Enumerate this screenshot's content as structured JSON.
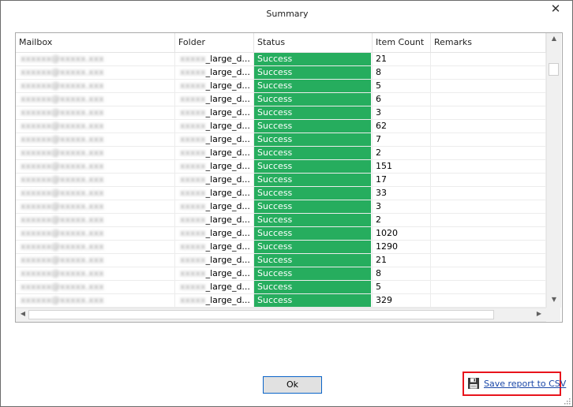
{
  "window": {
    "title": "Summary",
    "close_glyph": "✕"
  },
  "grid": {
    "columns": [
      "Mailbox",
      "Folder",
      "Status",
      "Item Count",
      "Remarks"
    ],
    "rows": [
      {
        "mailbox": "xxxxxx@xxxxx.xxx",
        "folder_prefix": "xxxxx",
        "folder": "_large_d...",
        "status": "Success",
        "count": "21",
        "remarks": ""
      },
      {
        "mailbox": "xxxxxx@xxxxx.xxx",
        "folder_prefix": "xxxxx",
        "folder": "_large_d...",
        "status": "Success",
        "count": "8",
        "remarks": ""
      },
      {
        "mailbox": "xxxxxx@xxxxx.xxx",
        "folder_prefix": "xxxxx",
        "folder": "_large_d...",
        "status": "Success",
        "count": "5",
        "remarks": ""
      },
      {
        "mailbox": "xxxxxx@xxxxx.xxx",
        "folder_prefix": "xxxxx",
        "folder": "_large_d...",
        "status": "Success",
        "count": "6",
        "remarks": ""
      },
      {
        "mailbox": "xxxxxx@xxxxx.xxx",
        "folder_prefix": "xxxxx",
        "folder": "_large_d...",
        "status": "Success",
        "count": "3",
        "remarks": ""
      },
      {
        "mailbox": "xxxxxx@xxxxx.xxx",
        "folder_prefix": "xxxxx",
        "folder": "_large_d...",
        "status": "Success",
        "count": "62",
        "remarks": ""
      },
      {
        "mailbox": "xxxxxx@xxxxx.xxx",
        "folder_prefix": "xxxxx",
        "folder": "_large_d...",
        "status": "Success",
        "count": "7",
        "remarks": ""
      },
      {
        "mailbox": "xxxxxx@xxxxx.xxx",
        "folder_prefix": "xxxxx",
        "folder": "_large_d...",
        "status": "Success",
        "count": "2",
        "remarks": ""
      },
      {
        "mailbox": "xxxxxx@xxxxx.xxx",
        "folder_prefix": "xxxxx",
        "folder": "_large_d...",
        "status": "Success",
        "count": "151",
        "remarks": ""
      },
      {
        "mailbox": "xxxxxx@xxxxx.xxx",
        "folder_prefix": "xxxxx",
        "folder": "_large_d...",
        "status": "Success",
        "count": "17",
        "remarks": ""
      },
      {
        "mailbox": "xxxxxx@xxxxx.xxx",
        "folder_prefix": "xxxxx",
        "folder": "_large_d...",
        "status": "Success",
        "count": "33",
        "remarks": ""
      },
      {
        "mailbox": "xxxxxx@xxxxx.xxx",
        "folder_prefix": "xxxxx",
        "folder": "_large_d...",
        "status": "Success",
        "count": "3",
        "remarks": ""
      },
      {
        "mailbox": "xxxxxx@xxxxx.xxx",
        "folder_prefix": "xxxxx",
        "folder": "_large_d...",
        "status": "Success",
        "count": "2",
        "remarks": ""
      },
      {
        "mailbox": "xxxxxx@xxxxx.xxx",
        "folder_prefix": "xxxxx",
        "folder": "_large_d...",
        "status": "Success",
        "count": "1020",
        "remarks": ""
      },
      {
        "mailbox": "xxxxxx@xxxxx.xxx",
        "folder_prefix": "xxxxx",
        "folder": "_large_d...",
        "status": "Success",
        "count": "1290",
        "remarks": ""
      },
      {
        "mailbox": "xxxxxx@xxxxx.xxx",
        "folder_prefix": "xxxxx",
        "folder": "_large_d...",
        "status": "Success",
        "count": "21",
        "remarks": ""
      },
      {
        "mailbox": "xxxxxx@xxxxx.xxx",
        "folder_prefix": "xxxxx",
        "folder": "_large_d...",
        "status": "Success",
        "count": "8",
        "remarks": ""
      },
      {
        "mailbox": "xxxxxx@xxxxx.xxx",
        "folder_prefix": "xxxxx",
        "folder": "_large_d...",
        "status": "Success",
        "count": "5",
        "remarks": ""
      },
      {
        "mailbox": "xxxxxx@xxxxx.xxx",
        "folder_prefix": "xxxxx",
        "folder": "_large_d...",
        "status": "Success",
        "count": "329",
        "remarks": ""
      }
    ],
    "status_color": "#26ad5e",
    "scroll_glyphs": {
      "up": "▲",
      "down": "▼",
      "left": "◀",
      "right": "▶"
    }
  },
  "footer": {
    "ok_label": "Ok",
    "save_csv_label": "Save report to CSV",
    "save_icon": "floppy-disk-icon",
    "highlight_color": "#e8141c",
    "link_color": "#1a47a8"
  }
}
